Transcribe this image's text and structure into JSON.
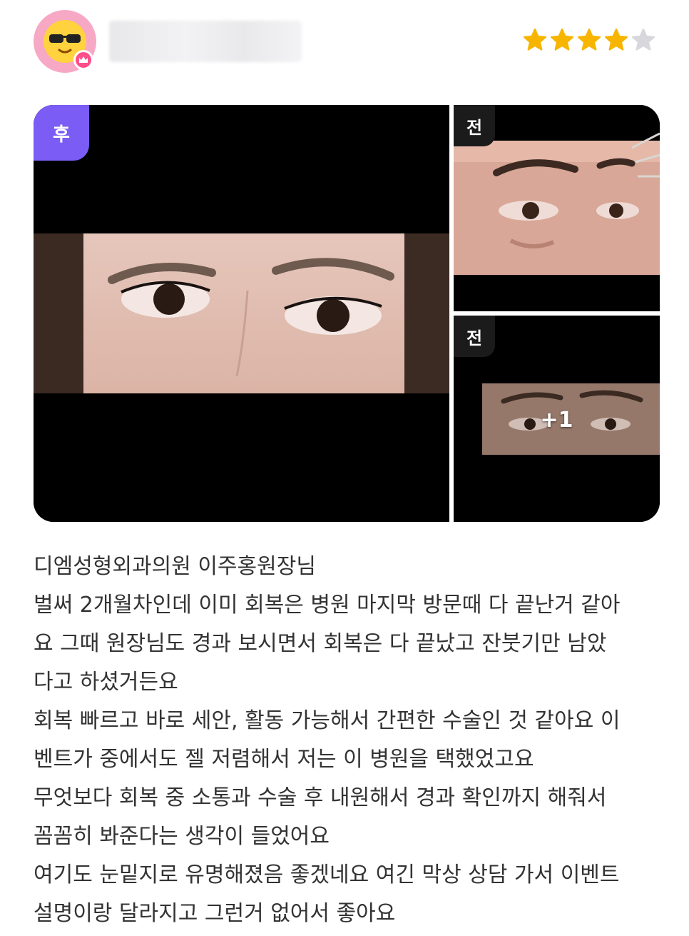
{
  "header": {
    "rating": {
      "value": 4,
      "max": 5
    },
    "colors": {
      "star_filled": "#f7b500",
      "star_empty": "#d8d8dc",
      "avatar_bg": "#f7a8c4"
    }
  },
  "gallery": {
    "main": {
      "badge": "후"
    },
    "side": [
      {
        "badge": "전"
      },
      {
        "badge": "전",
        "more": "+1"
      }
    ],
    "colors": {
      "after_badge": "#7b5cf5"
    }
  },
  "review": {
    "lines": [
      "디엠성형외과의원 이주홍원장님",
      "벌써 2개월차인데 이미 회복은 병원 마지막 방문때 다 끝난거 같아",
      "요 그때 원장님도 경과 보시면서 회복은 다 끝났고 잔붓기만 남았",
      "다고 하셨거든요",
      "회복 빠르고 바로 세안, 활동 가능해서 간편한 수술인 것 같아요 이",
      "벤트가 중에서도 젤 저렴해서 저는 이 병원을 택했었고요",
      "무엇보다 회복 중 소통과 수술 후 내원해서 경과 확인까지 해줘서",
      "꼼꼼히 봐준다는 생각이 들었어요",
      "여기도 눈밑지로 유명해졌음 좋겠네요 여긴 막상 상담 가서 이벤트",
      "설명이랑 달라지고 그런거 없어서 좋아요"
    ]
  }
}
